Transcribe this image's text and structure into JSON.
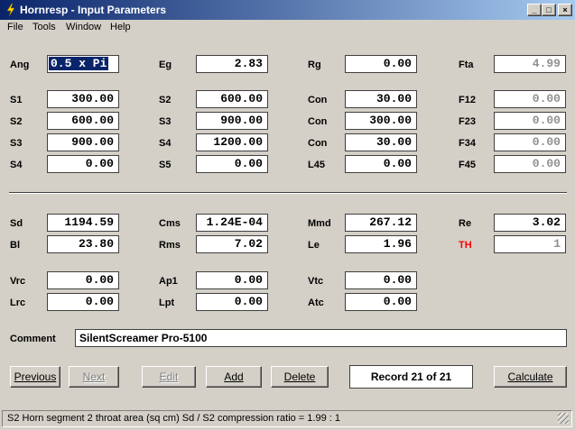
{
  "window": {
    "title": "Hornresp - Input Parameters",
    "controls": [
      "_",
      "□",
      "×"
    ]
  },
  "menu": [
    "File",
    "Tools",
    "Window",
    "Help"
  ],
  "params": {
    "ang": {
      "label": "Ang",
      "value": "0.5 x Pi"
    },
    "eg": {
      "label": "Eg",
      "value": "2.83"
    },
    "rg": {
      "label": "Rg",
      "value": "0.00"
    },
    "fta": {
      "label": "Fta",
      "value": "4.99"
    },
    "s1": {
      "label": "S1",
      "value": "300.00"
    },
    "s2a": {
      "label": "S2",
      "value": "600.00"
    },
    "con1": {
      "label": "Con",
      "value": "30.00"
    },
    "f12": {
      "label": "F12",
      "value": "0.00"
    },
    "s2b": {
      "label": "S2",
      "value": "600.00"
    },
    "s3a": {
      "label": "S3",
      "value": "900.00"
    },
    "con2": {
      "label": "Con",
      "value": "300.00"
    },
    "f23": {
      "label": "F23",
      "value": "0.00"
    },
    "s3b": {
      "label": "S3",
      "value": "900.00"
    },
    "s4a": {
      "label": "S4",
      "value": "1200.00"
    },
    "con3": {
      "label": "Con",
      "value": "30.00"
    },
    "f34": {
      "label": "F34",
      "value": "0.00"
    },
    "s4b": {
      "label": "S4",
      "value": "0.00"
    },
    "s5": {
      "label": "S5",
      "value": "0.00"
    },
    "l45": {
      "label": "L45",
      "value": "0.00"
    },
    "f45": {
      "label": "F45",
      "value": "0.00"
    },
    "sd": {
      "label": "Sd",
      "value": "1194.59"
    },
    "cms": {
      "label": "Cms",
      "value": "1.24E-04"
    },
    "mmd": {
      "label": "Mmd",
      "value": "267.12"
    },
    "re": {
      "label": "Re",
      "value": "3.02"
    },
    "bl": {
      "label": "Bl",
      "value": "23.80"
    },
    "rms": {
      "label": "Rms",
      "value": "7.02"
    },
    "le": {
      "label": "Le",
      "value": "1.96"
    },
    "th": {
      "label": "TH",
      "value": "1"
    },
    "vrc": {
      "label": "Vrc",
      "value": "0.00"
    },
    "ap1": {
      "label": "Ap1",
      "value": "0.00"
    },
    "vtc": {
      "label": "Vtc",
      "value": "0.00"
    },
    "lrc": {
      "label": "Lrc",
      "value": "0.00"
    },
    "lpt": {
      "label": "Lpt",
      "value": "0.00"
    },
    "atc": {
      "label": "Atc",
      "value": "0.00"
    }
  },
  "comment": {
    "label": "Comment",
    "value": "SilentScreamer Pro-5100"
  },
  "buttons": {
    "previous": "Previous",
    "next": "Next",
    "edit": "Edit",
    "add": "Add",
    "delete": "Delete",
    "calculate": "Calculate"
  },
  "record": "Record 21 of 21",
  "status": "S2   Horn segment 2 throat area  (sq cm)   Sd / S2 compression ratio = 1.99 : 1",
  "colors": {
    "title_start": "#0a246a",
    "title_end": "#a6caf0",
    "th_label": "#ff0000",
    "disabled_text": "#909090"
  }
}
